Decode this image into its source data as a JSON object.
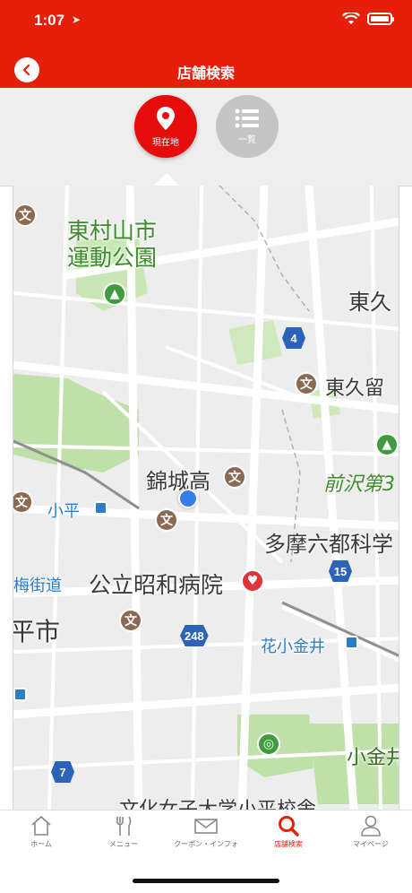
{
  "status_bar": {
    "time": "1:07",
    "location_arrow": "location-arrow-icon"
  },
  "header": {
    "title": "店舗検索",
    "back_icon": "chevron-left-icon",
    "bg_color": "#e51f0a"
  },
  "mode_toggle": {
    "current": {
      "label": "現在地",
      "icon": "map-pin-icon",
      "active_color": "#e60c0c"
    },
    "list": {
      "label": "一覧",
      "icon": "list-icon",
      "inactive_color": "#c4c4c4"
    }
  },
  "map": {
    "labels": {
      "park": "東村山市\n運動公園",
      "higashikurume": "東久",
      "higashikurume_school": "東久留",
      "kinjo": "錦城高",
      "kodaira": "小平",
      "maesawa": "前沢第3",
      "tama": "多摩六都科学",
      "ome_kaido": "梅街道",
      "hospital": "公立昭和病院",
      "kodaira_city": "平市",
      "hanakoganei": "花小金井",
      "koganei": "小金井",
      "bottom": "文化女子大学小平校舎"
    },
    "routes": [
      "4",
      "15",
      "248",
      "7"
    ],
    "poi_glyph": "文"
  },
  "tabbar": {
    "items": [
      {
        "label": "ホーム",
        "icon": "home-icon"
      },
      {
        "label": "メニュー",
        "icon": "fork-knife-icon"
      },
      {
        "label": "クーポン・インフォ",
        "icon": "envelope-icon"
      },
      {
        "label": "店舗検索",
        "icon": "search-icon"
      },
      {
        "label": "マイページ",
        "icon": "user-icon"
      }
    ],
    "active_index": 3,
    "active_color": "#e51f0a"
  }
}
